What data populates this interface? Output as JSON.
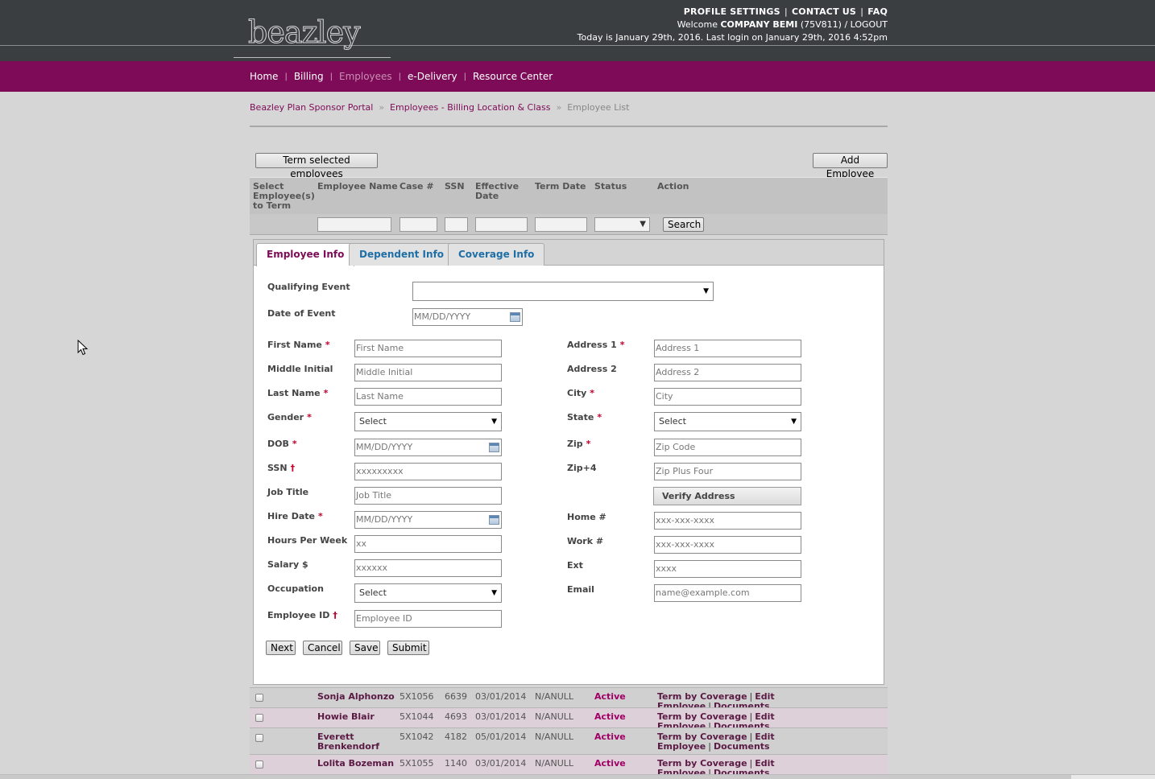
{
  "header": {
    "logo_text": "beazley",
    "links": [
      "PROFILE SETTINGS",
      "CONTACT US",
      "FAQ"
    ],
    "welcome_prefix": "Welcome ",
    "company": "COMPANY BEMI",
    "company_code": " (75V811) / LOGOUT",
    "date_line": "Today is January 29th, 2016. Last login on January 29th, 2016 4:52pm"
  },
  "nav": {
    "items": [
      "Home",
      "Billing",
      "Employees",
      "e-Delivery",
      "Resource Center"
    ],
    "active": "Employees"
  },
  "breadcrumb": {
    "items": [
      "Beazley Plan Sponsor Portal",
      "Employees - Billing Location & Class"
    ],
    "current": "Employee List",
    "separator": "»"
  },
  "toolbar": {
    "term_label": "Term selected employees",
    "add_label": "Add Employee"
  },
  "table": {
    "headers": [
      "Select Employee(s) to Term",
      "Employee Name",
      "Case #",
      "SSN",
      "Effective Date",
      "Term Date",
      "Status",
      "Action"
    ],
    "search_label": "Search",
    "status_select_value": "",
    "rows": [
      {
        "name": "Sonja Alphonzo",
        "case": "5X1056",
        "ssn": "6639",
        "effective": "03/01/2014",
        "term": "N/ANULL",
        "status": "Active"
      },
      {
        "name": "Howie Blair",
        "case": "5X1044",
        "ssn": "4693",
        "effective": "03/01/2014",
        "term": "N/ANULL",
        "status": "Active"
      },
      {
        "name": "Everett Brenkendorf",
        "case": "5X1042",
        "ssn": "4182",
        "effective": "05/01/2014",
        "term": "N/ANULL",
        "status": "Active"
      },
      {
        "name": "Lolita Bozeman",
        "case": "5X1055",
        "ssn": "1140",
        "effective": "03/01/2014",
        "term": "N/ANULL",
        "status": "Active"
      }
    ],
    "actions": [
      "Term by Coverage",
      "Edit Employee",
      "Documents"
    ]
  },
  "tabs": [
    "Employee Info",
    "Dependent Info",
    "Coverage Info"
  ],
  "form": {
    "qualifying_event_label": "Qualifying Event",
    "qualifying_event_value": "",
    "date_of_event_label": "Date of Event",
    "date_of_event_placeholder": "MM/DD/YYYY",
    "first_name_label": "First Name",
    "first_name_placeholder": "First Name",
    "middle_initial_label": "Middle Initial",
    "middle_initial_placeholder": "Middle Initial",
    "last_name_label": "Last Name",
    "last_name_placeholder": "Last Name",
    "gender_label": "Gender",
    "gender_value": "Select",
    "dob_label": "DOB",
    "dob_placeholder": "MM/DD/YYYY",
    "ssn_label": "SSN",
    "ssn_placeholder": "xxxxxxxxx",
    "job_title_label": "Job Title",
    "job_title_placeholder": "Job Title",
    "hire_date_label": "Hire Date",
    "hire_date_placeholder": "MM/DD/YYYY",
    "hours_label": "Hours Per Week",
    "hours_placeholder": "xx",
    "salary_label": "Salary $",
    "salary_placeholder": "xxxxxx",
    "occupation_label": "Occupation",
    "occupation_value": "Select",
    "employee_id_label": "Employee ID",
    "employee_id_placeholder": "Employee ID",
    "address1_label": "Address 1",
    "address1_placeholder": "Address 1",
    "address2_label": "Address 2",
    "address2_placeholder": "Address 2",
    "city_label": "City",
    "city_placeholder": "City",
    "state_label": "State",
    "state_value": "Select",
    "zip_label": "Zip",
    "zip_placeholder": "Zip Code",
    "zip4_label": "Zip+4",
    "zip4_placeholder": "Zip Plus Four",
    "verify_label": "Verify Address",
    "home_label": "Home #",
    "home_placeholder": "xxx-xxx-xxxx",
    "work_label": "Work #",
    "work_placeholder": "xxx-xxx-xxxx",
    "ext_label": "Ext",
    "ext_placeholder": "xxxx",
    "email_label": "Email",
    "email_placeholder": "name@example.com",
    "required_mark": "*",
    "dagger_mark": "†",
    "buttons": {
      "next": "Next",
      "cancel": "Cancel",
      "save": "Save",
      "submit": "Submit"
    }
  },
  "colors": {
    "brand": "#7d0b57",
    "header": "#3b3e41",
    "tab_link": "#1f6fa7",
    "status_active": "#a00066"
  }
}
